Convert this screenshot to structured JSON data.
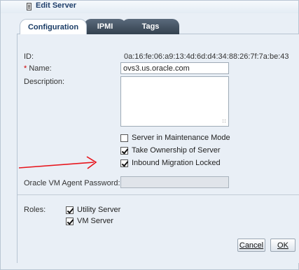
{
  "background": {
    "text": "or"
  },
  "window": {
    "title": "Edit Server"
  },
  "tabs": [
    {
      "label": "Configuration",
      "active": true
    },
    {
      "label": "IPMI",
      "active": false
    },
    {
      "label": "Tags",
      "active": false
    }
  ],
  "form": {
    "id_label": "ID:",
    "id_value": "0a:16:fe:06:a9:13:4d:6d:d4:34:88:26:7f:7a:be:43",
    "name_required_mark": "*",
    "name_label": "Name:",
    "name_value": "ovs3.us.oracle.com",
    "description_label": "Description:",
    "description_value": "",
    "checkboxes": [
      {
        "label": "Server in Maintenance Mode",
        "checked": false
      },
      {
        "label": "Take Ownership of Server",
        "checked": true
      },
      {
        "label": "Inbound Migration Locked",
        "checked": true
      }
    ],
    "agent_password_label": "Oracle VM Agent Password:",
    "agent_password_value": "",
    "roles_label": "Roles:",
    "roles": [
      {
        "label": "Utility Server",
        "checked": true
      },
      {
        "label": "VM Server",
        "checked": true
      }
    ]
  },
  "buttons": {
    "cancel": "Cancel",
    "ok": "OK"
  },
  "colors": {
    "annotation_arrow": "#e8141b",
    "tab_active_bg": "#ffffff",
    "tab_inactive_bg": "#3f4d5c"
  },
  "icons": {
    "title": "document-icon"
  }
}
